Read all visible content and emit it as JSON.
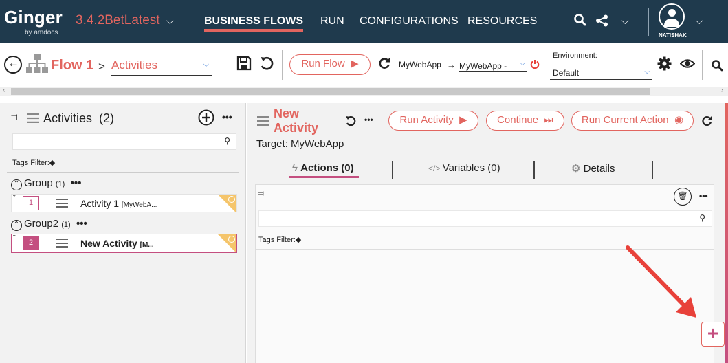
{
  "app": {
    "logo": "Ginger",
    "logo_sub": "by amdocs",
    "version": "3.4.2BetLatest"
  },
  "nav": {
    "items": [
      "BUSINESS FLOWS",
      "RUN",
      "CONFIGURATIONS",
      "RESOURCES"
    ],
    "active": "BUSINESS FLOWS",
    "user_name": "NATISHAK"
  },
  "toolbar": {
    "flow_name": "Flow 1",
    "crumb_separator": ">",
    "crumb_page": "Activities",
    "run_flow_label": "Run Flow",
    "app_name": "MyWebApp",
    "agent_value": "MyWebApp -",
    "env_label": "Environment:",
    "env_value": "Default"
  },
  "left_pane": {
    "title": "Activities",
    "count": "(2)",
    "tags_filter_label": "Tags Filter:",
    "groups": [
      {
        "name": "Group",
        "count": "(1)",
        "activities": [
          {
            "number": "1",
            "name": "Activity 1",
            "target": "[MyWebA...",
            "selected": false
          }
        ]
      },
      {
        "name": "Group2",
        "count": "(1)",
        "activities": [
          {
            "number": "2",
            "name": "New Activity",
            "target": "[M...",
            "selected": true
          }
        ]
      }
    ]
  },
  "right_pane": {
    "activity_title_line1": "New",
    "activity_title_line2": "Activity",
    "run_activity_label": "Run Activity",
    "continue_label": "Continue",
    "run_current_action_label": "Run Current Action",
    "target_text": "Target: MyWebApp",
    "tabs": [
      "Actions (0)",
      "Variables (0)",
      "Details"
    ],
    "active_tab": "Actions (0)",
    "tags_filter_label": "Tags Filter:",
    "add_label": "+"
  },
  "colors": {
    "nav_bg": "#1f3a4d",
    "accent": "#e2655f",
    "accent_dark": "#c44f80",
    "group_badge": "#f5c56b",
    "annotation_arrow": "#e8413a"
  },
  "icons": [
    "chevron-down-icon",
    "search-icon",
    "share-icon",
    "user-avatar-icon",
    "back-arrow-icon",
    "flow-tree-icon",
    "save-icon",
    "undo-icon",
    "play-icon",
    "refresh-icon",
    "arrow-right-icon",
    "power-icon",
    "gear-icon",
    "eye-icon",
    "collapse-icon",
    "list-icon",
    "plus-circle-icon",
    "ellipsis-icon",
    "tag-icon",
    "lightning-icon",
    "code-icon",
    "trash-icon",
    "drag-handle-icon",
    "fast-forward-icon",
    "record-icon"
  ]
}
